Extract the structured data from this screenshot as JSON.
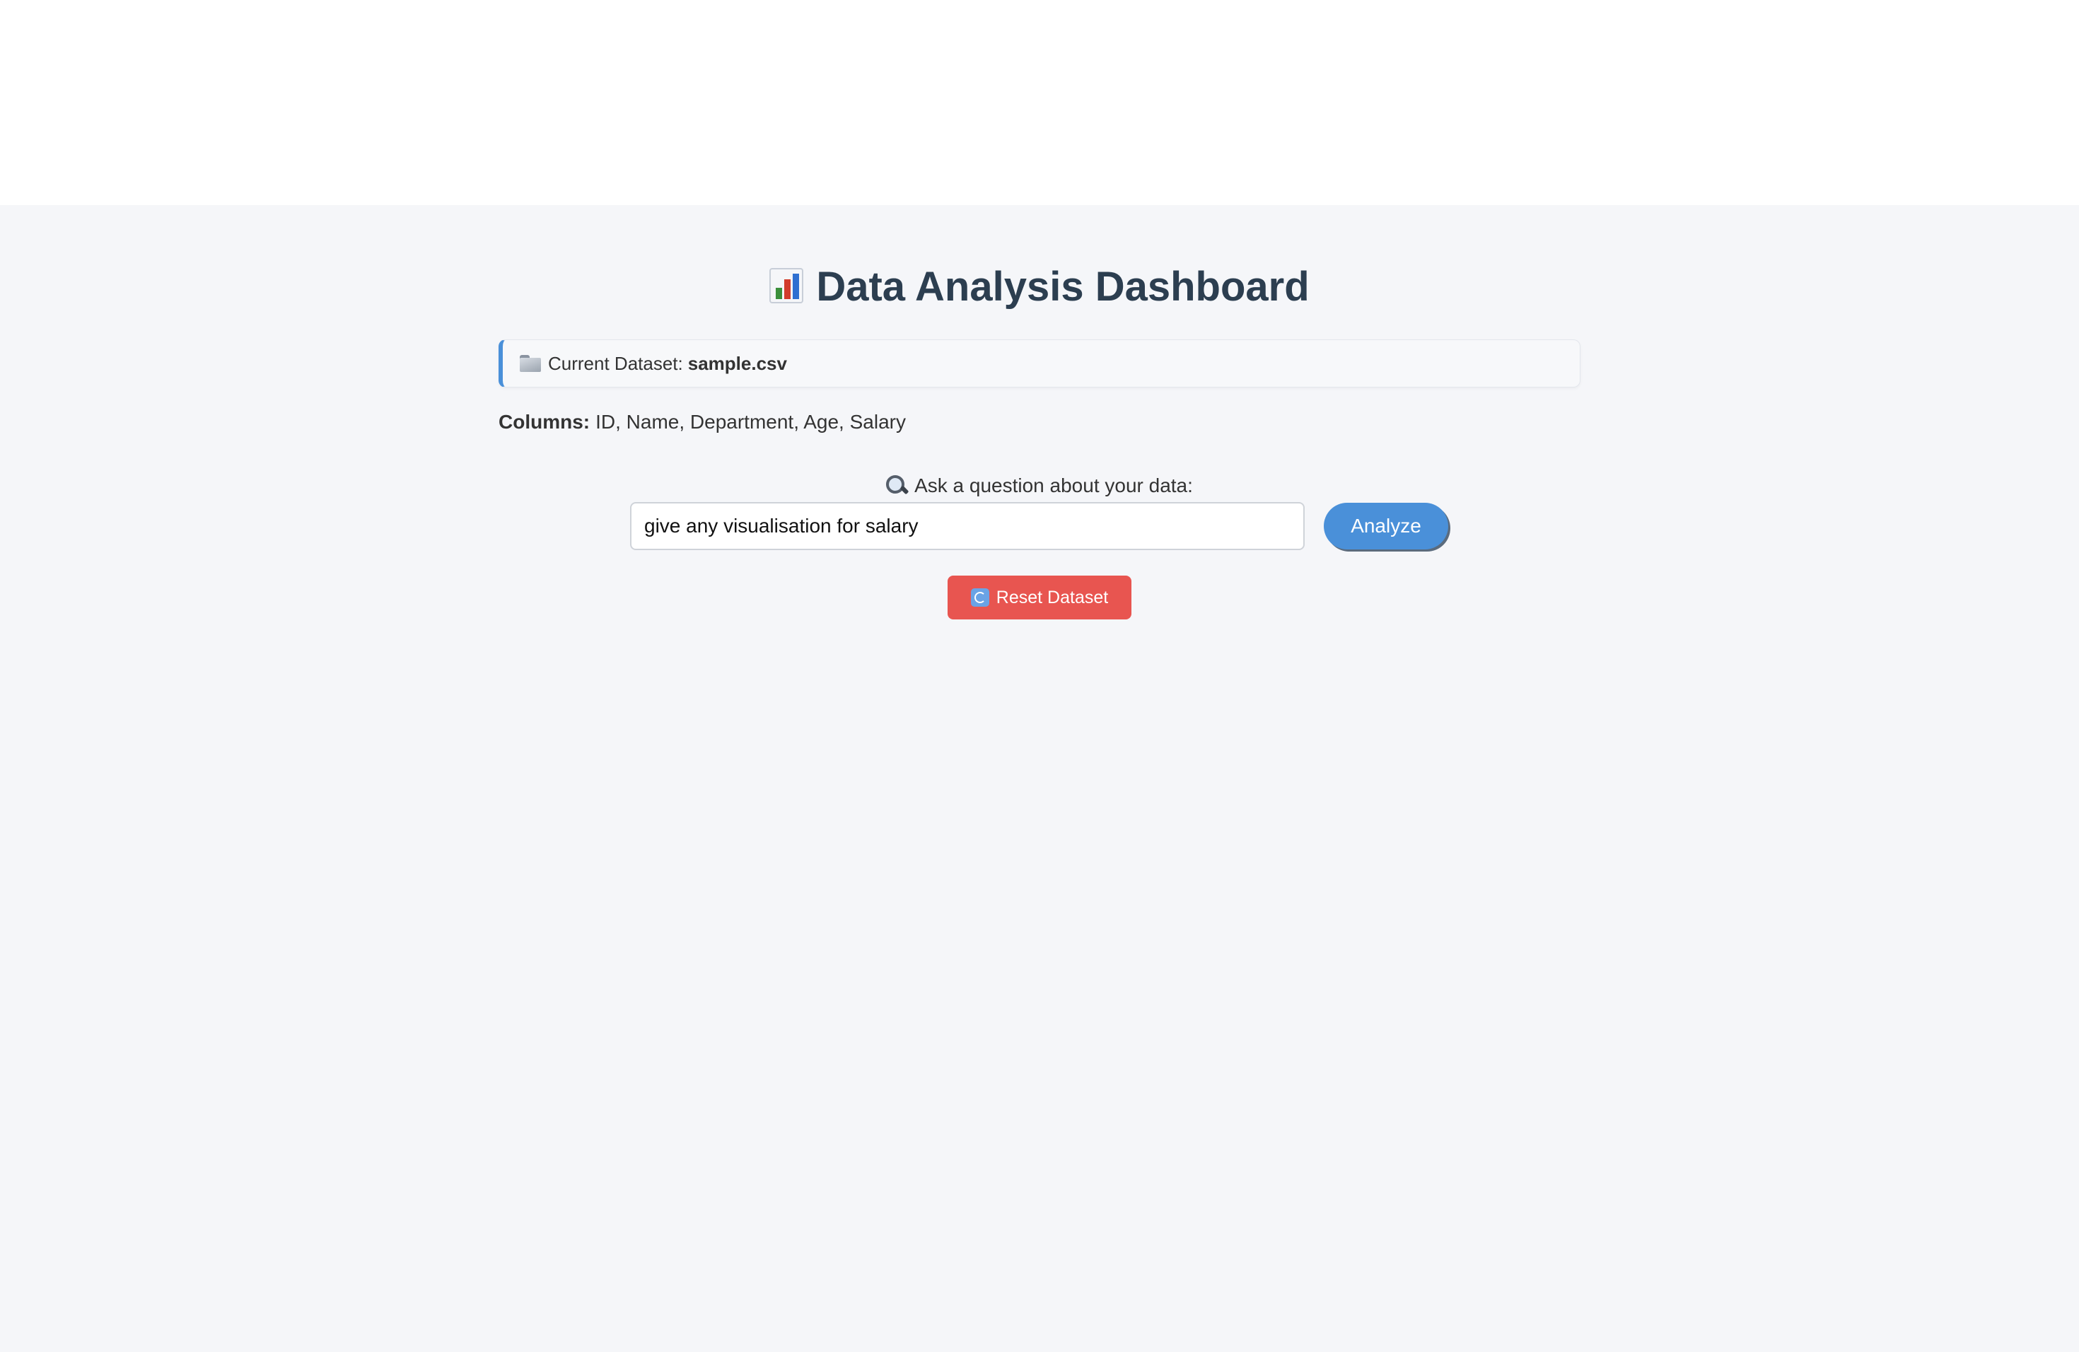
{
  "header": {
    "title": "Data Analysis Dashboard",
    "title_icon": "bar-chart-icon"
  },
  "dataset": {
    "label": "Current Dataset:",
    "name": "sample.csv",
    "icon": "folder-icon"
  },
  "columns": {
    "label": "Columns:",
    "value": "ID, Name, Department, Age, Salary"
  },
  "query": {
    "label": "Ask a question about your data:",
    "icon": "search-icon",
    "value": "give any visualisation for salary",
    "analyze_label": "Analyze"
  },
  "reset": {
    "label": "Reset Dataset",
    "icon": "refresh-icon"
  },
  "colors": {
    "accent": "#4a90d9",
    "danger": "#e85550",
    "title": "#2c3e50",
    "background": "#f5f6f9"
  }
}
